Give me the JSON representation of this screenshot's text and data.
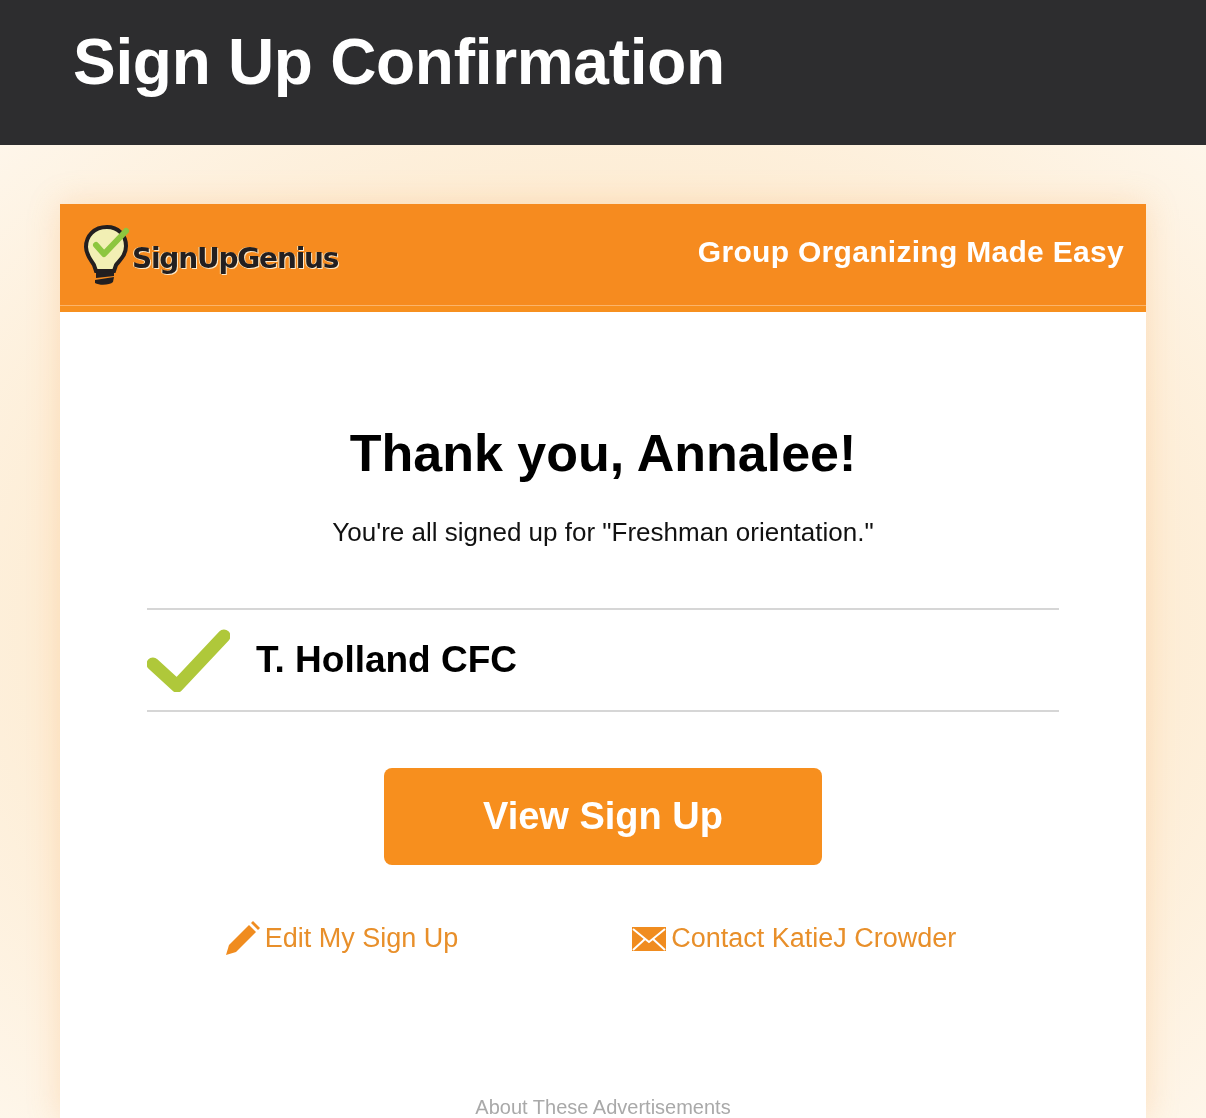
{
  "page_header": {
    "title": "Sign Up Confirmation"
  },
  "card": {
    "header": {
      "logo_text": "SignUpGenius",
      "tagline": "Group Organizing Made Easy"
    },
    "heading": "Thank you, Annalee!",
    "message": "You're all signed up for \"Freshman orientation.\"",
    "slots": [
      {
        "name": "T. Holland CFC",
        "checked": true
      }
    ],
    "primary_button": "View Sign Up",
    "links": [
      {
        "kind": "edit",
        "label": "Edit My Sign Up"
      },
      {
        "kind": "contact",
        "label": "Contact KatieJ Crowder"
      }
    ],
    "footer_note": "About These Advertisements"
  }
}
